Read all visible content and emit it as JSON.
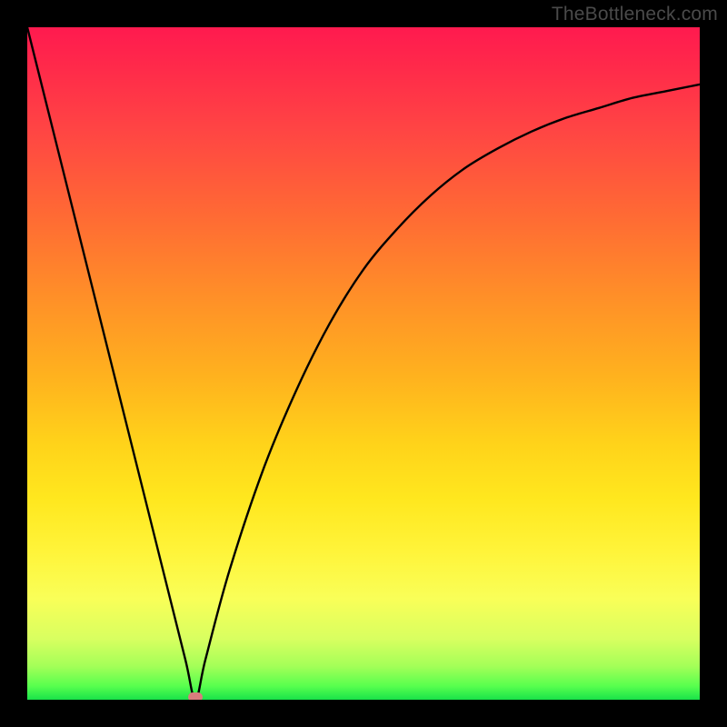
{
  "watermark": "TheBottleneck.com",
  "chart_data": {
    "type": "line",
    "title": "",
    "xlabel": "",
    "ylabel": "",
    "xlim": [
      0,
      1
    ],
    "ylim": [
      0,
      1
    ],
    "grid": false,
    "annotations": [
      {
        "name": "minimum-marker",
        "x": 0.25,
        "y": 0.0
      }
    ],
    "series": [
      {
        "name": "bottleneck-curve",
        "x": [
          0.0,
          0.05,
          0.1,
          0.15,
          0.2,
          0.235,
          0.25,
          0.265,
          0.3,
          0.35,
          0.4,
          0.45,
          0.5,
          0.55,
          0.6,
          0.65,
          0.7,
          0.75,
          0.8,
          0.85,
          0.9,
          0.95,
          1.0
        ],
        "values": [
          1.0,
          0.8,
          0.6,
          0.4,
          0.2,
          0.06,
          0.0,
          0.06,
          0.19,
          0.34,
          0.46,
          0.56,
          0.64,
          0.7,
          0.75,
          0.79,
          0.82,
          0.845,
          0.865,
          0.88,
          0.895,
          0.905,
          0.915
        ]
      }
    ],
    "colors": {
      "curve": "#000000",
      "marker": "#d87d7d",
      "gradient_top": "#ff1a4f",
      "gradient_bottom": "#19e24a",
      "frame": "#000000"
    }
  }
}
